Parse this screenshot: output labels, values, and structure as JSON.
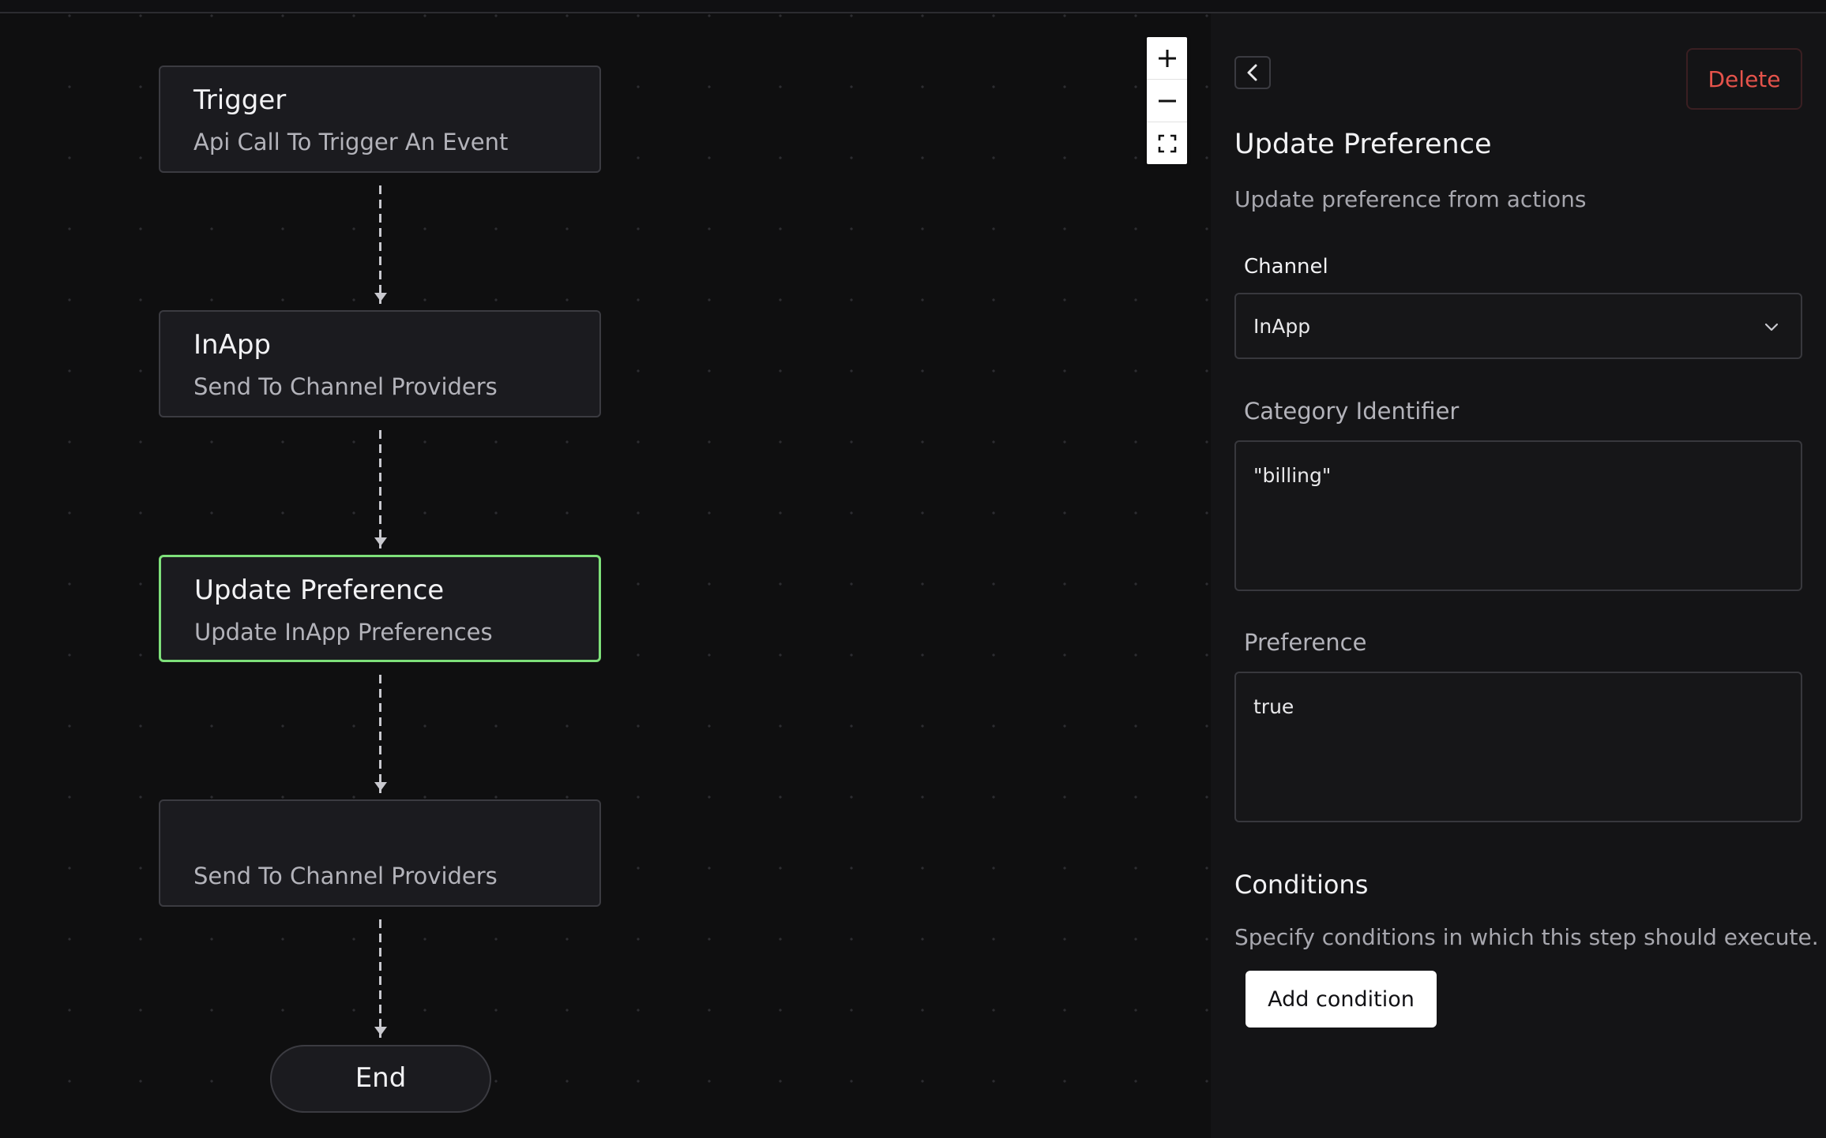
{
  "workflow": {
    "nodes": [
      {
        "title": "Trigger",
        "subtitle": "Api Call To Trigger An Event"
      },
      {
        "title": "InApp",
        "subtitle": "Send To Channel Providers"
      },
      {
        "title": "Update Preference",
        "subtitle": "Update InApp Preferences"
      },
      {
        "title": "",
        "subtitle": "Send To Channel Providers"
      }
    ],
    "end_label": "End",
    "selected_node_index": 2
  },
  "zoom_controls": {
    "zoom_in_icon": "plus-icon",
    "zoom_out_icon": "minus-icon",
    "fit_view_icon": "fit-view-icon"
  },
  "panel": {
    "back_icon": "chevron-left-icon",
    "delete_label": "Delete",
    "title": "Update Preference",
    "description": "Update preference from actions",
    "channel": {
      "label": "Channel",
      "value": "InApp"
    },
    "category": {
      "label": "Category Identifier",
      "value": "\"billing\""
    },
    "preference": {
      "label": "Preference",
      "value": "true"
    },
    "conditions": {
      "title": "Conditions",
      "description": "Specify conditions in which this step should execute.",
      "add_label": "Add condition"
    }
  },
  "colors": {
    "background": "#0f0f10",
    "node_background": "#1b1b1f",
    "selected_border": "#7ee07a",
    "delete_text": "#e5534b"
  }
}
